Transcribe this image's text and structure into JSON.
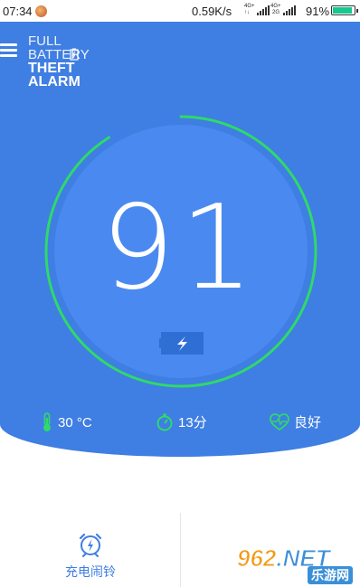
{
  "status_bar": {
    "time": "07:34",
    "speed": "0.59K/s",
    "net1_top": "4G+",
    "net1_bottom": "↑↓",
    "net2_top": "4G+",
    "net2_bottom": "2G",
    "battery_pct": "91%",
    "battery_level": 0.91
  },
  "app": {
    "logo_line1": "FULL",
    "logo_line2": "BATTERY",
    "logo_line3": "THEFT",
    "logo_line4": "ALARM"
  },
  "gauge": {
    "value": "91",
    "level": 0.91,
    "track_color": "#2fd96a"
  },
  "stats": {
    "temperature": "30 °C",
    "time_left": "13分",
    "health": "良好"
  },
  "bottom_nav": {
    "charge_alarm_label": "充电闹铃"
  },
  "watermark": {
    "brand": "962",
    "suffix": ".NET",
    "cn": "乐游网"
  },
  "colors": {
    "primary": "#3f7ee2",
    "accent_green": "#2fd96a"
  }
}
